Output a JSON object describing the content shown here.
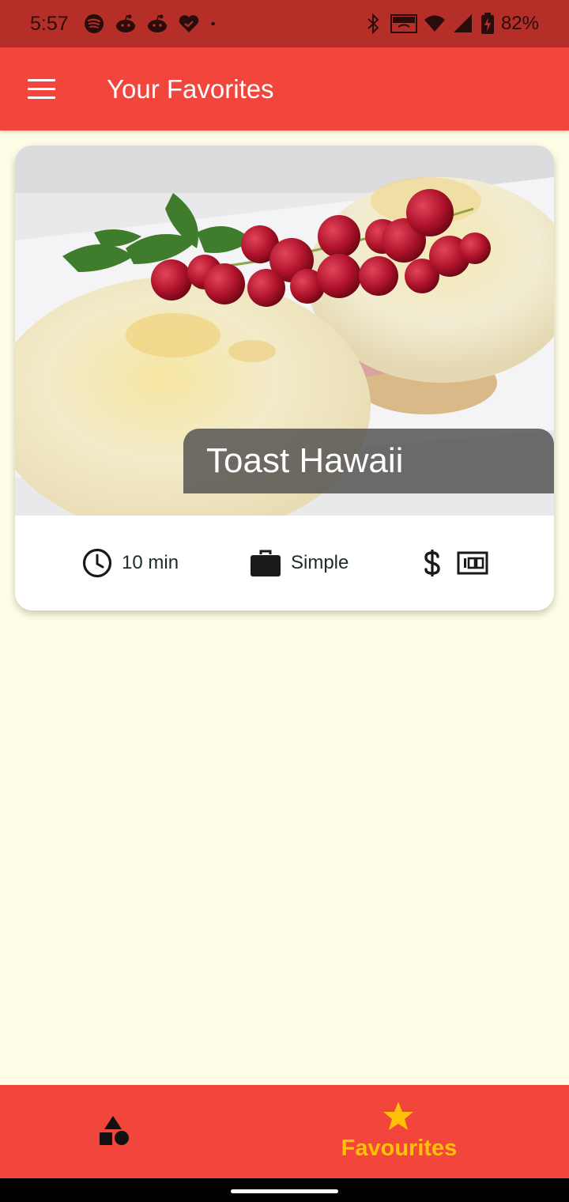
{
  "status_bar": {
    "time": "5:57",
    "battery_percent": "82%",
    "left_icons": [
      "spotify-icon",
      "reddit-icon",
      "reddit-icon",
      "heart-check-icon",
      "dot-icon"
    ],
    "right_icons": [
      "bluetooth-icon",
      "vowifi-icon",
      "wifi-icon",
      "signal-icon",
      "battery-charging-icon"
    ]
  },
  "app_bar": {
    "title": "Your Favorites",
    "menu_icon": "hamburger-menu-icon",
    "color": "#f2453b"
  },
  "meal_card": {
    "title": "Toast Hawaii",
    "duration": "10 min",
    "complexity": "Simple",
    "affordability_icons": [
      "dollar-icon",
      "money-bill-icon"
    ]
  },
  "bottom_nav": {
    "items": [
      {
        "icon": "category-shapes-icon",
        "label": "",
        "selected": false
      },
      {
        "icon": "star-icon",
        "label": "Favourites",
        "selected": true
      }
    ],
    "active_color": "#ffc107"
  },
  "colors": {
    "primary": "#f2453b",
    "status_bar": "#b52f28",
    "background": "#fffde5",
    "accent": "#ffc107"
  }
}
